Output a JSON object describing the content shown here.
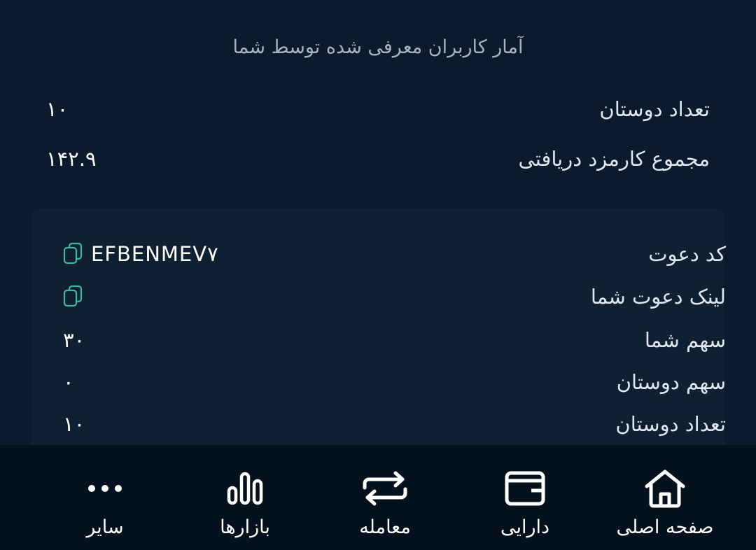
{
  "stats": {
    "title": "آمار کاربران معرفی شده توسط شما",
    "rows": [
      {
        "label": "تعداد دوستان",
        "value": "۱۰"
      },
      {
        "label": "مجموع کارمزد دریافتی",
        "value": "۱۴۲.۹"
      }
    ]
  },
  "invite": {
    "code_label": "کد دعوت",
    "code_value": "EFBENMEV۷",
    "link_label": "لینک دعوت شما",
    "your_share_label": "سهم شما",
    "your_share_value": "۳۰",
    "friends_share_label": "سهم دوستان",
    "friends_share_value": "۰",
    "friends_count_label": "تعداد دوستان",
    "friends_count_value": "۱۰"
  },
  "nav": {
    "home": "صفحه اصلی",
    "assets": "دارایی",
    "trade": "معامله",
    "markets": "بازارها",
    "more": "سایر"
  },
  "colors": {
    "background": "#0b1a2c",
    "card": "#0f2033",
    "nav_background": "#06111e",
    "copy_icon": "#3fb8a0"
  }
}
